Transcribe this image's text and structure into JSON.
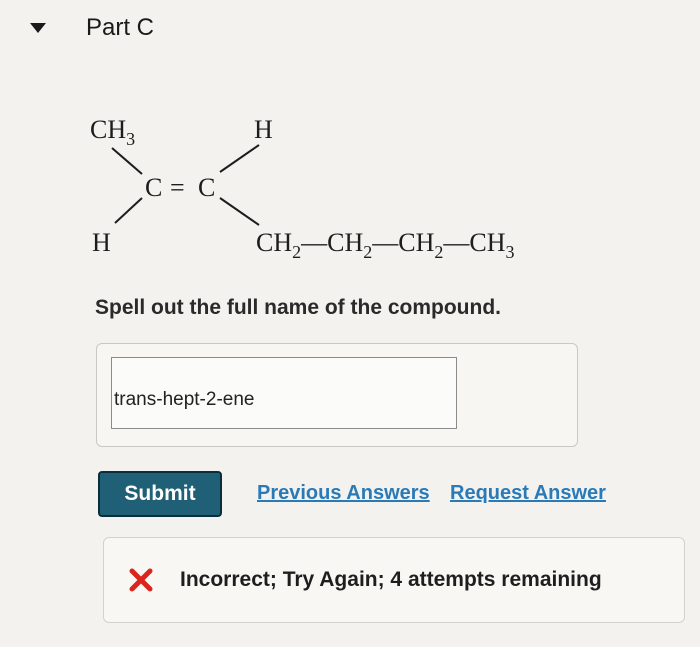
{
  "part": {
    "title": "Part C"
  },
  "structure": {
    "left_top": "CH",
    "left_top_sub": "3",
    "right_top": "H",
    "left_bottom": "H",
    "center_left_c": "C",
    "double_bond": "=",
    "center_right_c": "C",
    "chain": [
      {
        "text": "CH",
        "sub": "2"
      },
      {
        "text": "CH",
        "sub": "2"
      },
      {
        "text": "CH",
        "sub": "2"
      },
      {
        "text": "CH",
        "sub": "3"
      }
    ],
    "chain_bond": "—"
  },
  "question": {
    "prompt": "Spell out the full name of the compound."
  },
  "answer": {
    "value": "trans-hept-2-ene"
  },
  "actions": {
    "submit_label": "Submit",
    "previous_answers_label": "Previous Answers",
    "request_answer_label": "Request Answer"
  },
  "feedback": {
    "icon": "x-icon",
    "text": "Incorrect; Try Again; 4 attempts remaining",
    "icon_color": "#d9251d"
  }
}
